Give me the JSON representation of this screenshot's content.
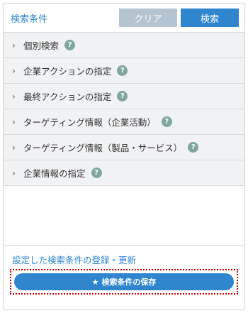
{
  "header": {
    "title": "検索条件",
    "clear_label": "クリア",
    "search_label": "検索"
  },
  "conditions": [
    {
      "label": "個別検索",
      "help": "?"
    },
    {
      "label": "企業アクションの指定",
      "help": "?"
    },
    {
      "label": "最終アクションの指定",
      "help": "?"
    },
    {
      "label": "ターゲティング情報（企業活動）",
      "help": "?"
    },
    {
      "label": "ターゲティング情報（製品・サービス）",
      "help": "?"
    },
    {
      "label": "企業情報の指定",
      "help": "?"
    }
  ],
  "footer": {
    "register_link": "設定した検索条件の登録・更新",
    "save_label": "検索条件の保存",
    "save_icon": "★"
  },
  "icons": {
    "chevron": "›"
  },
  "colors": {
    "accent": "#2f86cf",
    "clear_button": "#b5c4d1",
    "help_icon": "#7fa6a0",
    "highlight_outline": "#cc0000"
  }
}
